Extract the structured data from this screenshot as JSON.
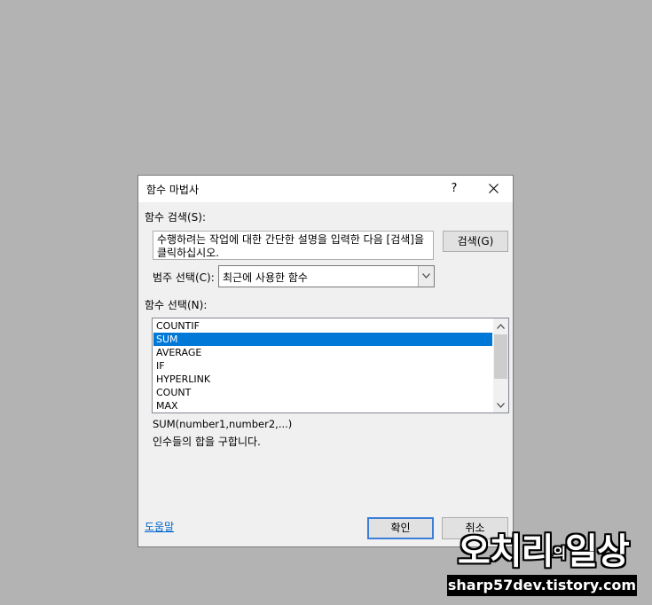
{
  "dialog": {
    "title": "함수 마법사",
    "help_button": "?",
    "search_label": "함수 검색(S):",
    "search_text": "수행하려는 작업에 대한 간단한 설명을 입력한 다음 [검색]을 클릭하십시오.",
    "search_button": "검색(G)",
    "category_label": "범주 선택(C):",
    "category_value": "최근에 사용한 함수",
    "function_label": "함수 선택(N):",
    "functions": [
      "COUNTIF",
      "SUM",
      "AVERAGE",
      "IF",
      "HYPERLINK",
      "COUNT",
      "MAX"
    ],
    "selected_function": "SUM",
    "syntax": "SUM(number1,number2,...)",
    "description": "인수들의 합을 구합니다.",
    "help_link": "도움말",
    "ok_button": "확인",
    "cancel_button": "취소"
  },
  "watermark": {
    "title_main": "오치리",
    "title_small": "의",
    "title_end": "일상",
    "url": "sharp57dev.tistory.com"
  },
  "colors": {
    "background": "#b3b3b3",
    "selection": "#0078d7",
    "default_button_border": "#3c7fd8",
    "link": "#0066cc"
  },
  "icons": {
    "close": "close-icon",
    "dropdown": "chevron-down-icon",
    "scroll_up": "chevron-up-icon",
    "scroll_down": "chevron-down-icon"
  }
}
